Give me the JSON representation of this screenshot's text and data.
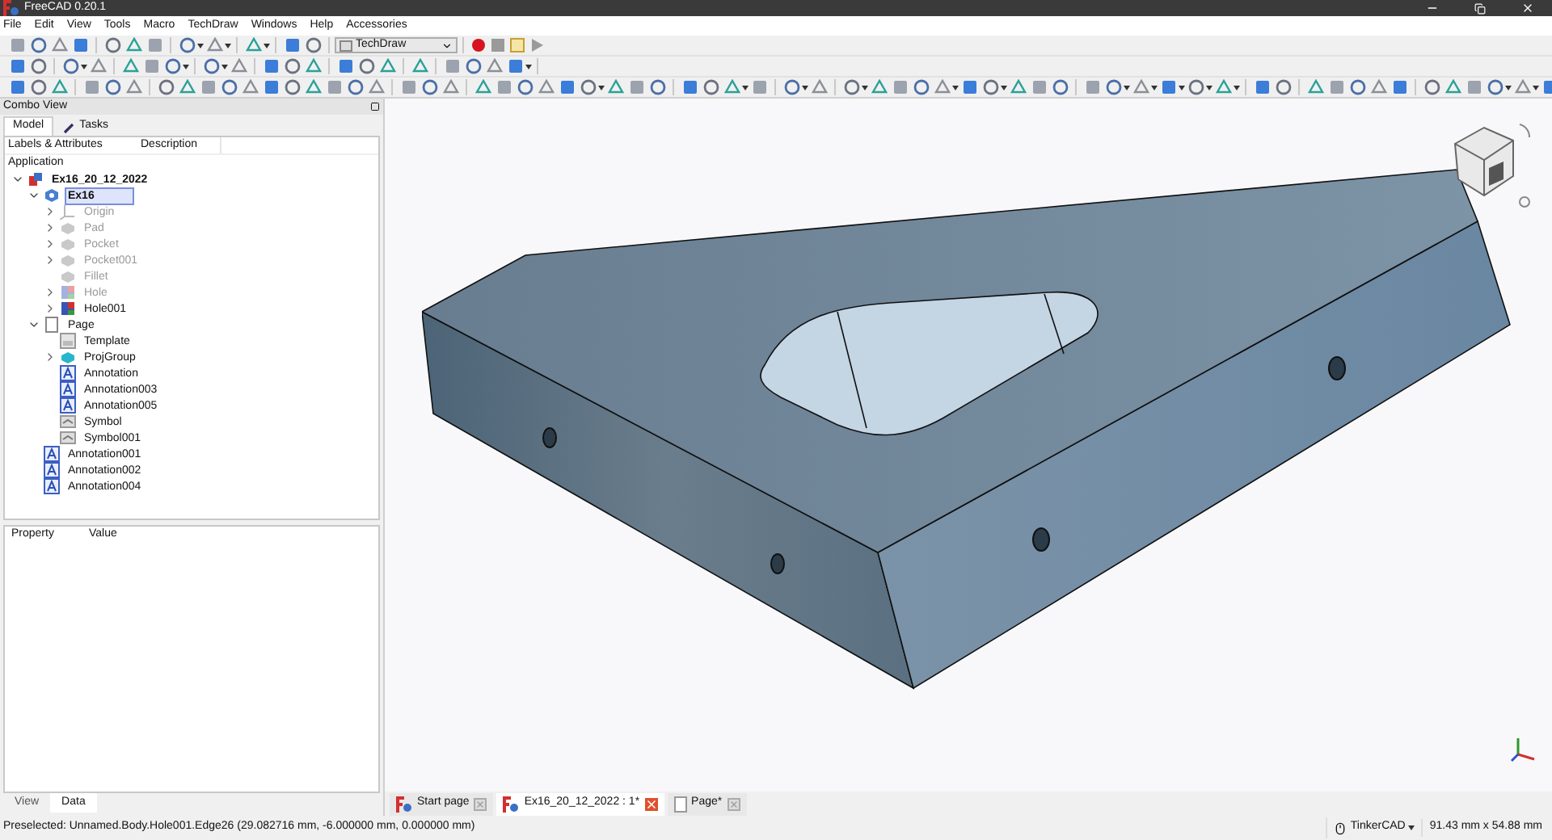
{
  "window": {
    "title": "FreeCAD 0.20.1"
  },
  "menu": [
    "File",
    "Edit",
    "View",
    "Tools",
    "Macro",
    "TechDraw",
    "Windows",
    "Help",
    "Accessories"
  ],
  "workbench": "TechDraw",
  "combo_view": {
    "title": "Combo View",
    "tabs": [
      {
        "label": "Model",
        "selected": true,
        "kind": "model"
      },
      {
        "label": "Tasks",
        "selected": false,
        "kind": "tasks"
      }
    ],
    "columns": [
      "Labels & Attributes",
      "Description"
    ],
    "root": "Application",
    "tree": [
      {
        "label": "Ex16_20_12_2022",
        "kind": "document",
        "expanded": true,
        "bold": true,
        "children": [
          {
            "label": "Ex16",
            "kind": "body",
            "expanded": true,
            "bold": true,
            "selected": true,
            "children": [
              {
                "label": "Origin",
                "kind": "origin",
                "expanded": false,
                "disabled": true
              },
              {
                "label": "Pad",
                "kind": "feature",
                "expanded": false,
                "disabled": true
              },
              {
                "label": "Pocket",
                "kind": "feature",
                "expanded": false,
                "disabled": true
              },
              {
                "label": "Pocket001",
                "kind": "feature",
                "expanded": false,
                "disabled": true
              },
              {
                "label": "Fillet",
                "kind": "feature",
                "disabled": true
              },
              {
                "label": "Hole",
                "kind": "hole",
                "expanded": false,
                "disabled": true
              },
              {
                "label": "Hole001",
                "kind": "hole",
                "expanded": false,
                "disabled": false
              }
            ]
          },
          {
            "label": "Page",
            "kind": "page",
            "expanded": true,
            "children": [
              {
                "label": "Template",
                "kind": "template"
              },
              {
                "label": "ProjGroup",
                "kind": "group",
                "expanded": false
              },
              {
                "label": "Annotation",
                "kind": "annotation"
              },
              {
                "label": "Annotation003",
                "kind": "annotation"
              },
              {
                "label": "Annotation005",
                "kind": "annotation"
              },
              {
                "label": "Symbol",
                "kind": "symbol"
              },
              {
                "label": "Symbol001",
                "kind": "symbol"
              }
            ]
          },
          {
            "label": "Annotation001",
            "kind": "annotation"
          },
          {
            "label": "Annotation002",
            "kind": "annotation"
          },
          {
            "label": "Annotation004",
            "kind": "annotation"
          }
        ]
      }
    ]
  },
  "property_view": {
    "columns": [
      "Property",
      "Value"
    ],
    "tabs": [
      {
        "label": "View",
        "selected": false
      },
      {
        "label": "Data",
        "selected": true
      }
    ]
  },
  "document_tabs": [
    {
      "label": "Start page",
      "selected": false,
      "kind": "start"
    },
    {
      "label": "Ex16_20_12_2022 : 1*",
      "selected": true,
      "kind": "model"
    },
    {
      "label": "Page*",
      "selected": false,
      "kind": "page"
    }
  ],
  "status_bar": {
    "message": "Preselected: Unnamed.Body.Hole001.Edge26 (29.082716 mm, -6.000000 mm, 0.000000 mm)",
    "navigation": "TinkerCAD",
    "dimensions": "91.43 mm x 54.88 mm"
  }
}
